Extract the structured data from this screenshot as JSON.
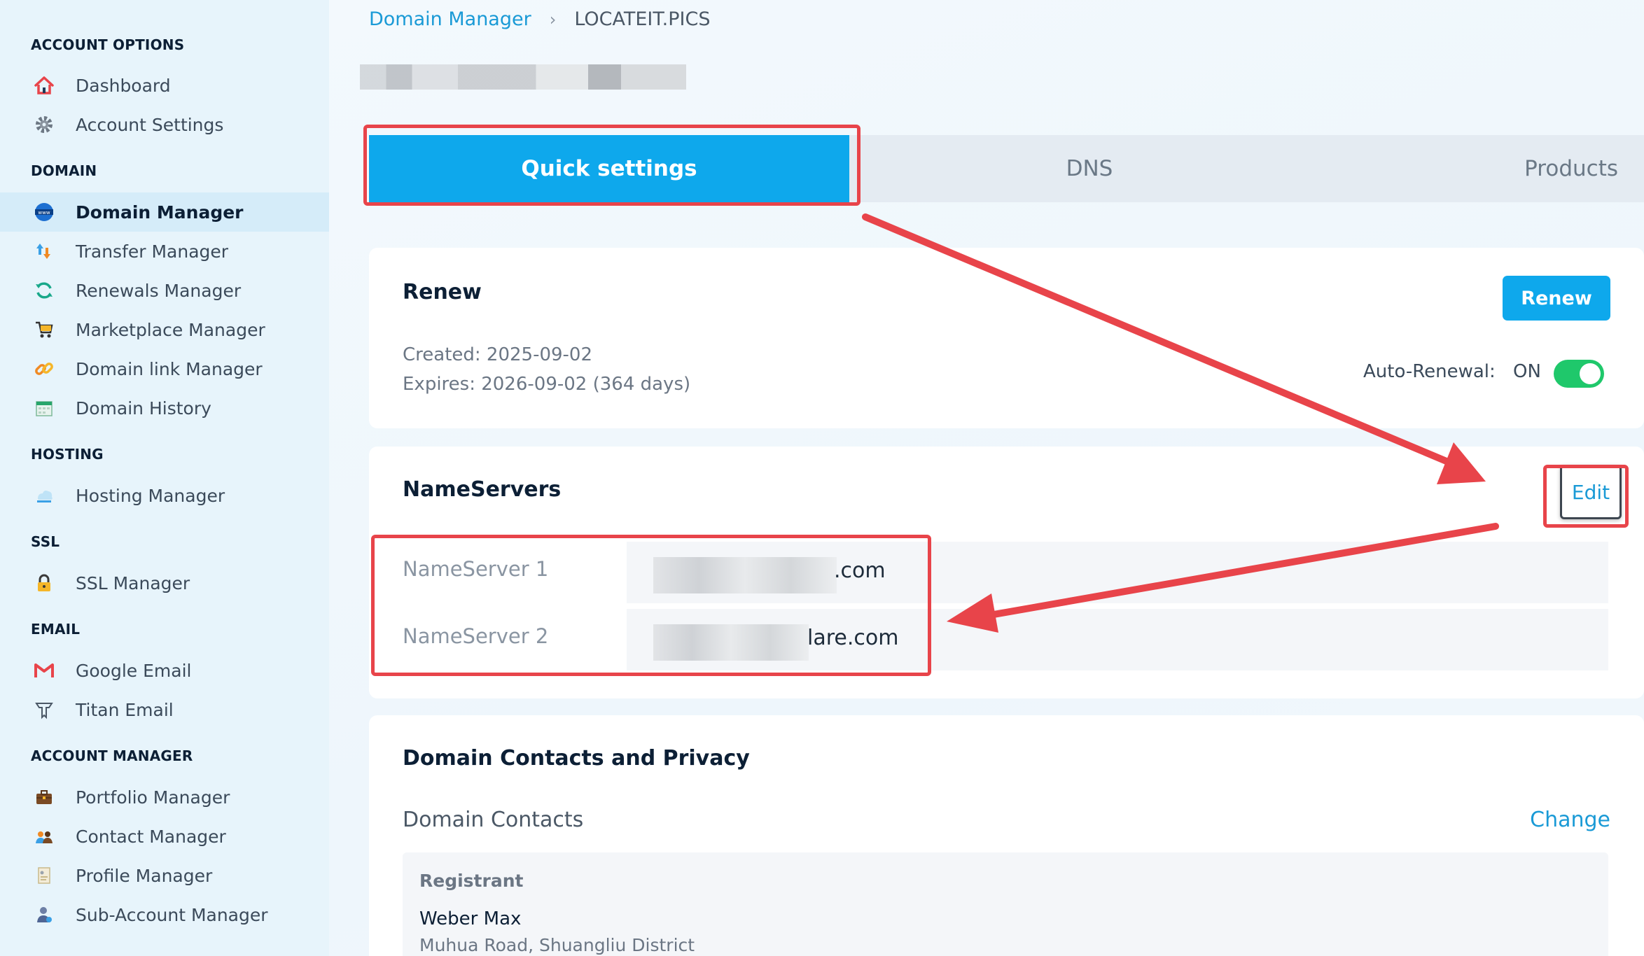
{
  "sidebar": {
    "sections": [
      {
        "title": "ACCOUNT OPTIONS",
        "items": [
          {
            "label": "Dashboard",
            "icon": "home-icon"
          },
          {
            "label": "Account Settings",
            "icon": "gear-icon"
          }
        ]
      },
      {
        "title": "DOMAIN",
        "items": [
          {
            "label": "Domain Manager",
            "icon": "www-globe-icon",
            "active": true
          },
          {
            "label": "Transfer Manager",
            "icon": "transfer-arrows-icon"
          },
          {
            "label": "Renewals Manager",
            "icon": "refresh-icon"
          },
          {
            "label": "Marketplace Manager",
            "icon": "cart-icon"
          },
          {
            "label": "Domain link Manager",
            "icon": "link-icon"
          },
          {
            "label": "Domain History",
            "icon": "calendar-icon"
          }
        ]
      },
      {
        "title": "HOSTING",
        "items": [
          {
            "label": "Hosting Manager",
            "icon": "cloud-icon"
          }
        ]
      },
      {
        "title": "SSL",
        "items": [
          {
            "label": "SSL Manager",
            "icon": "lock-icon"
          }
        ]
      },
      {
        "title": "EMAIL",
        "items": [
          {
            "label": "Google Email",
            "icon": "gmail-icon"
          },
          {
            "label": "Titan Email",
            "icon": "titan-icon"
          }
        ]
      },
      {
        "title": "ACCOUNT MANAGER",
        "items": [
          {
            "label": "Portfolio Manager",
            "icon": "briefcase-icon"
          },
          {
            "label": "Contact Manager",
            "icon": "contacts-icon"
          },
          {
            "label": "Profile Manager",
            "icon": "profile-card-icon"
          },
          {
            "label": "Sub-Account Manager",
            "icon": "sub-account-icon"
          }
        ]
      }
    ]
  },
  "breadcrumb": {
    "parent": "Domain Manager",
    "separator": "›",
    "current": "LOCATEIT.PICS"
  },
  "tabs": [
    "Quick settings",
    "DNS",
    "Products"
  ],
  "renew": {
    "title": "Renew",
    "button": "Renew",
    "created": "Created: 2025-09-02",
    "expires": "Expires: 2026-09-02 (364 days)",
    "auto_renew_label": "Auto-Renewal:",
    "auto_renew_state": "ON"
  },
  "nameservers": {
    "title": "NameServers",
    "edit": "Edit",
    "rows": [
      {
        "label": "NameServer 1",
        "value_suffix": ".com"
      },
      {
        "label": "NameServer 2",
        "value_suffix": "lare.com"
      }
    ]
  },
  "contacts": {
    "title": "Domain Contacts and Privacy",
    "subtitle": "Domain Contacts",
    "change": "Change",
    "registrant_label": "Registrant",
    "registrant_name": "Weber Max",
    "registrant_address": "Muhua Road, Shuangliu District"
  },
  "colors": {
    "accent": "#0ea8ec",
    "annotation": "#e8444a",
    "toggle_on": "#1fc86b"
  }
}
